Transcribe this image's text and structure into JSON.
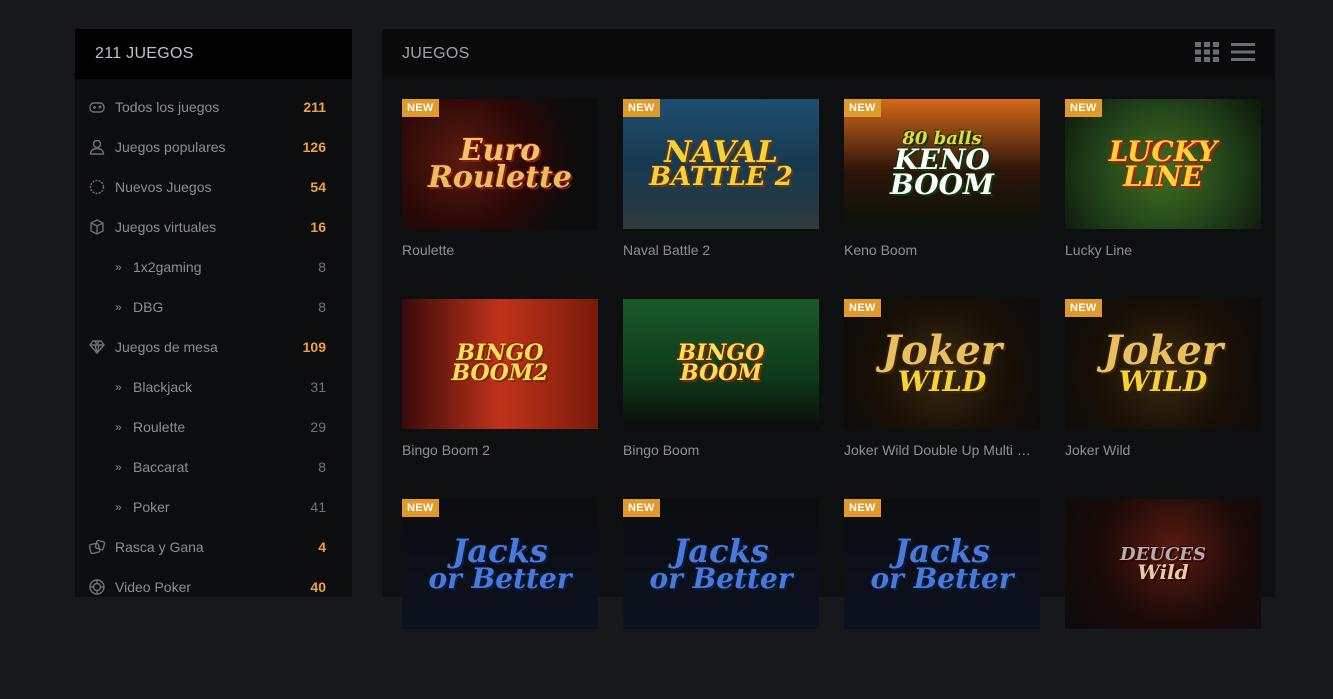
{
  "sidebar": {
    "title": "211 JUEGOS",
    "items": [
      {
        "label": "Todos los juegos",
        "count": "211",
        "icon": "gamepad-icon",
        "sub": false,
        "hi": true
      },
      {
        "label": "Juegos populares",
        "count": "126",
        "icon": "user-icon",
        "sub": false,
        "hi": true
      },
      {
        "label": "Nuevos Juegos",
        "count": "54",
        "icon": "badge-icon",
        "sub": false,
        "hi": true
      },
      {
        "label": "Juegos virtuales",
        "count": "16",
        "icon": "cube-icon",
        "sub": false,
        "hi": true
      },
      {
        "label": "1x2gaming",
        "count": "8",
        "icon": "chevron-right-icon",
        "sub": true,
        "hi": false
      },
      {
        "label": "DBG",
        "count": "8",
        "icon": "chevron-right-icon",
        "sub": true,
        "hi": false
      },
      {
        "label": "Juegos de mesa",
        "count": "109",
        "icon": "diamond-icon",
        "sub": false,
        "hi": true
      },
      {
        "label": "Blackjack",
        "count": "31",
        "icon": "chevron-right-icon",
        "sub": true,
        "hi": false
      },
      {
        "label": "Roulette",
        "count": "29",
        "icon": "chevron-right-icon",
        "sub": true,
        "hi": false
      },
      {
        "label": "Baccarat",
        "count": "8",
        "icon": "chevron-right-icon",
        "sub": true,
        "hi": false
      },
      {
        "label": "Poker",
        "count": "41",
        "icon": "chevron-right-icon",
        "sub": true,
        "hi": false
      },
      {
        "label": "Rasca y Gana",
        "count": "4",
        "icon": "dice-icon",
        "sub": false,
        "hi": true
      },
      {
        "label": "Video Poker",
        "count": "40",
        "icon": "chip-icon",
        "sub": false,
        "hi": true
      }
    ]
  },
  "main": {
    "title": "JUEGOS",
    "badge_label": "NEW",
    "games": [
      {
        "name": "Roulette",
        "is_new": true,
        "art_text": [
          "Euro",
          "Roulette"
        ]
      },
      {
        "name": "Naval Battle 2",
        "is_new": true,
        "art_text": [
          "NAVAL",
          "BATTLE 2"
        ]
      },
      {
        "name": "Keno Boom",
        "is_new": true,
        "art_text": [
          "80 balls",
          "KENO BOOM"
        ]
      },
      {
        "name": "Lucky Line",
        "is_new": true,
        "art_text": [
          "LUCKY",
          "LINE"
        ]
      },
      {
        "name": "Bingo Boom 2",
        "is_new": false,
        "art_text": [
          "BINGO",
          "BOOM2"
        ]
      },
      {
        "name": "Bingo Boom",
        "is_new": false,
        "art_text": [
          "BINGO",
          "BOOM"
        ]
      },
      {
        "name": "Joker Wild Double Up Multi Hand",
        "is_new": true,
        "art_text": [
          "Joker",
          "WILD"
        ]
      },
      {
        "name": "Joker Wild",
        "is_new": true,
        "art_text": [
          "Joker",
          "WILD"
        ]
      },
      {
        "name": "",
        "is_new": true,
        "art_text": [
          "Jacks",
          "or Better"
        ]
      },
      {
        "name": "",
        "is_new": true,
        "art_text": [
          "Jacks",
          "or Better"
        ]
      },
      {
        "name": "",
        "is_new": true,
        "art_text": [
          "Jacks",
          "or Better"
        ]
      },
      {
        "name": "",
        "is_new": false,
        "art_text": [
          "DEUCES",
          "Wild"
        ]
      }
    ]
  },
  "colors": {
    "accent": "#f0a13a",
    "badge": "#e09a2b",
    "bg": "#16181c",
    "panel": "#0e0f11"
  }
}
